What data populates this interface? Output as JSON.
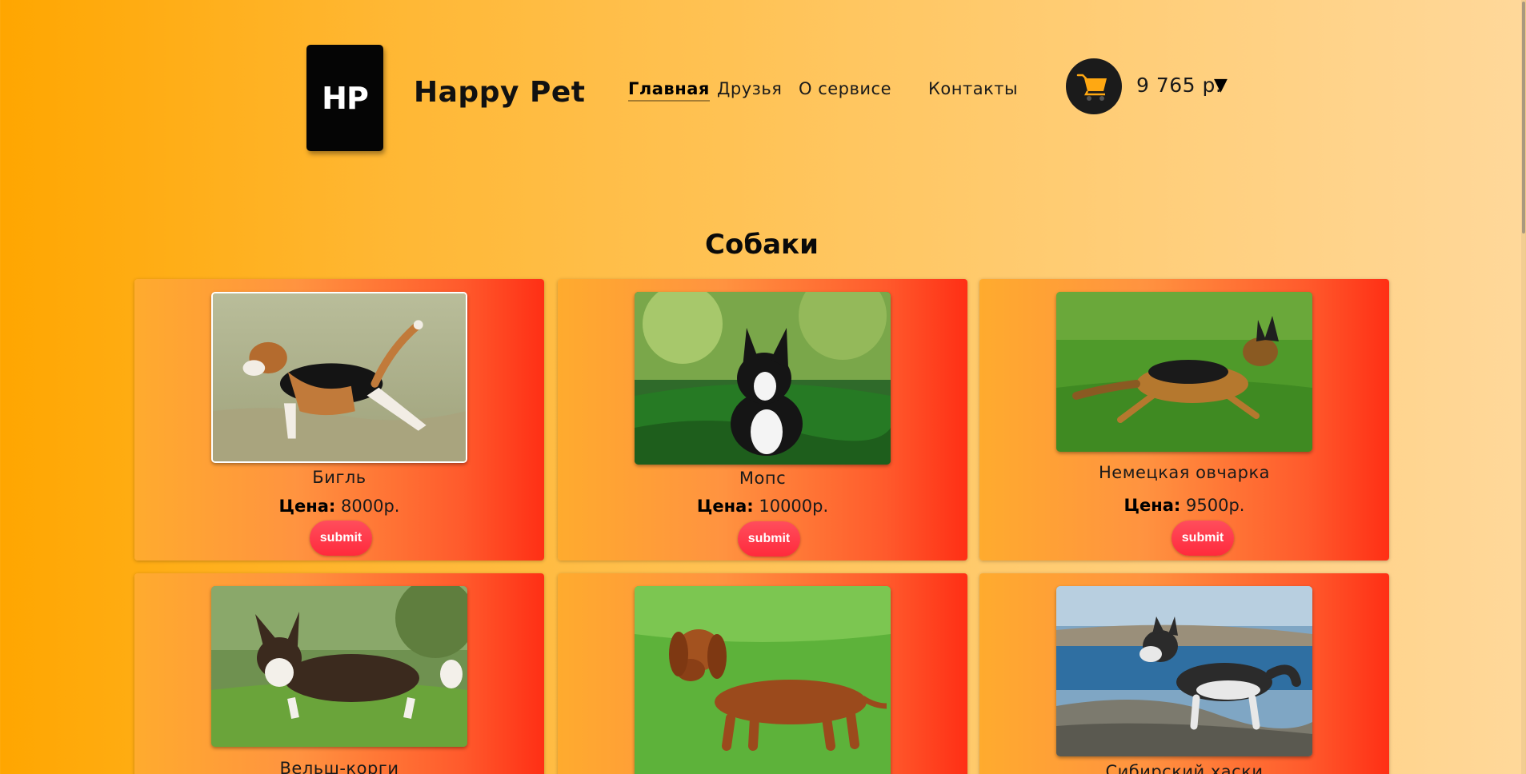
{
  "header": {
    "logo_text": "HP",
    "brand": "Happy Pet",
    "nav": [
      "Главная",
      "Друзья",
      "О сервисе",
      "Контакты"
    ],
    "active_nav": "Главная",
    "cart_icon": "shopping-cart-icon",
    "cart_total": "9 765 р.",
    "cart_caret": "▼"
  },
  "section": {
    "title": "Собаки"
  },
  "products": [
    {
      "name": "Бигль",
      "price_label": "Цена:",
      "price": "8000р.",
      "button": "submit"
    },
    {
      "name": "Мопс",
      "price_label": "Цена:",
      "price": "10000р.",
      "button": "submit"
    },
    {
      "name": "Немецкая овчарка",
      "price_label": "Цена:",
      "price": "9500р.",
      "button": "submit"
    },
    {
      "name": "Вельш-корги"
    },
    {
      "name": ""
    },
    {
      "name": "Сибирский хаски"
    }
  ],
  "colors": {
    "bg_left": "#ffa600",
    "bg_right": "#ffd89a",
    "card_left": "#ffab2e",
    "card_right": "#ff2f15",
    "button": "#ff3446",
    "logo_bg": "#050505"
  }
}
